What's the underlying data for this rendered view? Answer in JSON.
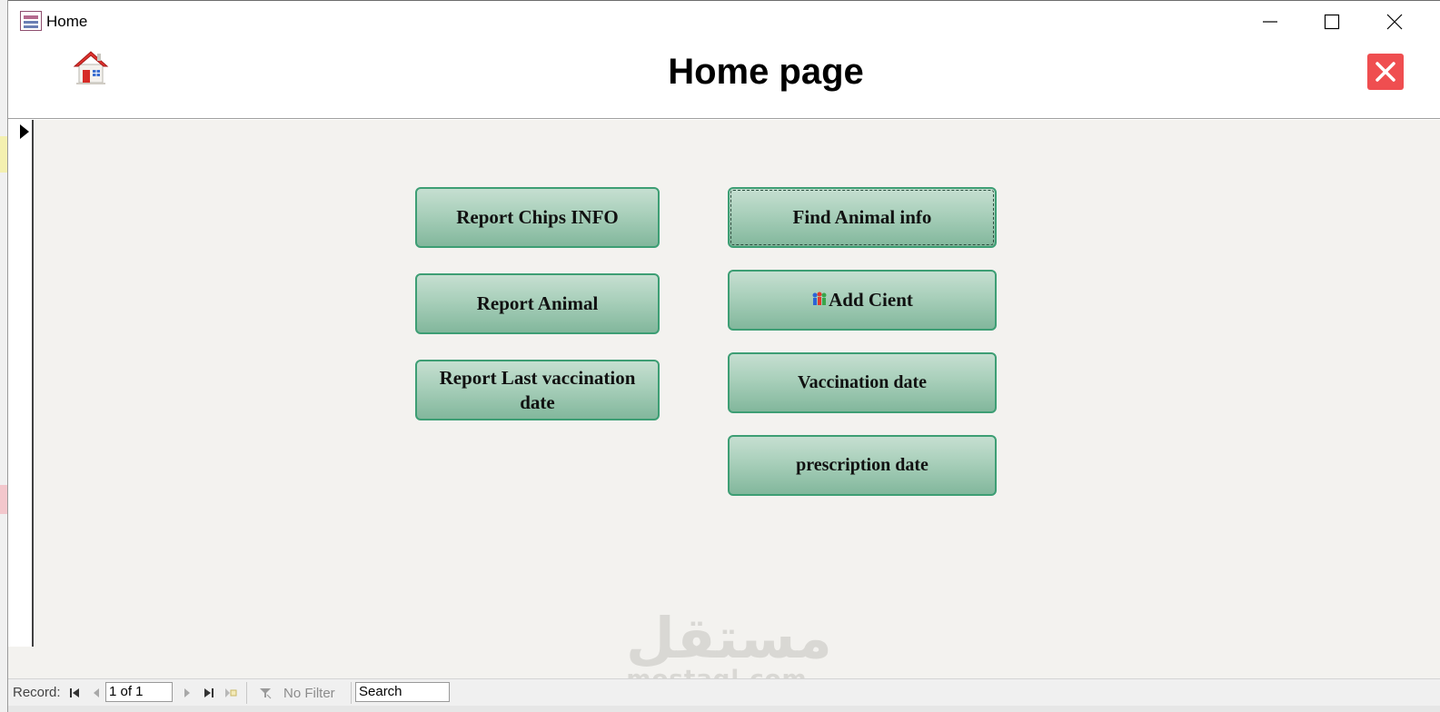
{
  "window": {
    "title": "Home",
    "controls": {
      "minimize": "minimize",
      "maximize": "maximize",
      "close": "close"
    }
  },
  "header": {
    "title": "Home page",
    "home_icon": "home-icon",
    "close_icon": "close-icon",
    "accent_close_color": "#ef4e50"
  },
  "buttons": {
    "report_chips_info": "Report Chips INFO",
    "report_animal": "Report Animal",
    "report_last_vaccination": "Report Last vaccination date",
    "find_animal_info": "Find Animal info",
    "add_client": "Add Cient",
    "vaccination_date": "Vaccination date",
    "prescription_date": "prescription date",
    "button_color": "#82b79c",
    "button_border_color": "#3d9e74"
  },
  "watermark": {
    "arabic": "مستقل",
    "latin": "mostaql.com"
  },
  "navigation": {
    "record_label": "Record:",
    "current_record": "1 of 1",
    "filter_label": "No Filter",
    "search_value": "Search"
  }
}
